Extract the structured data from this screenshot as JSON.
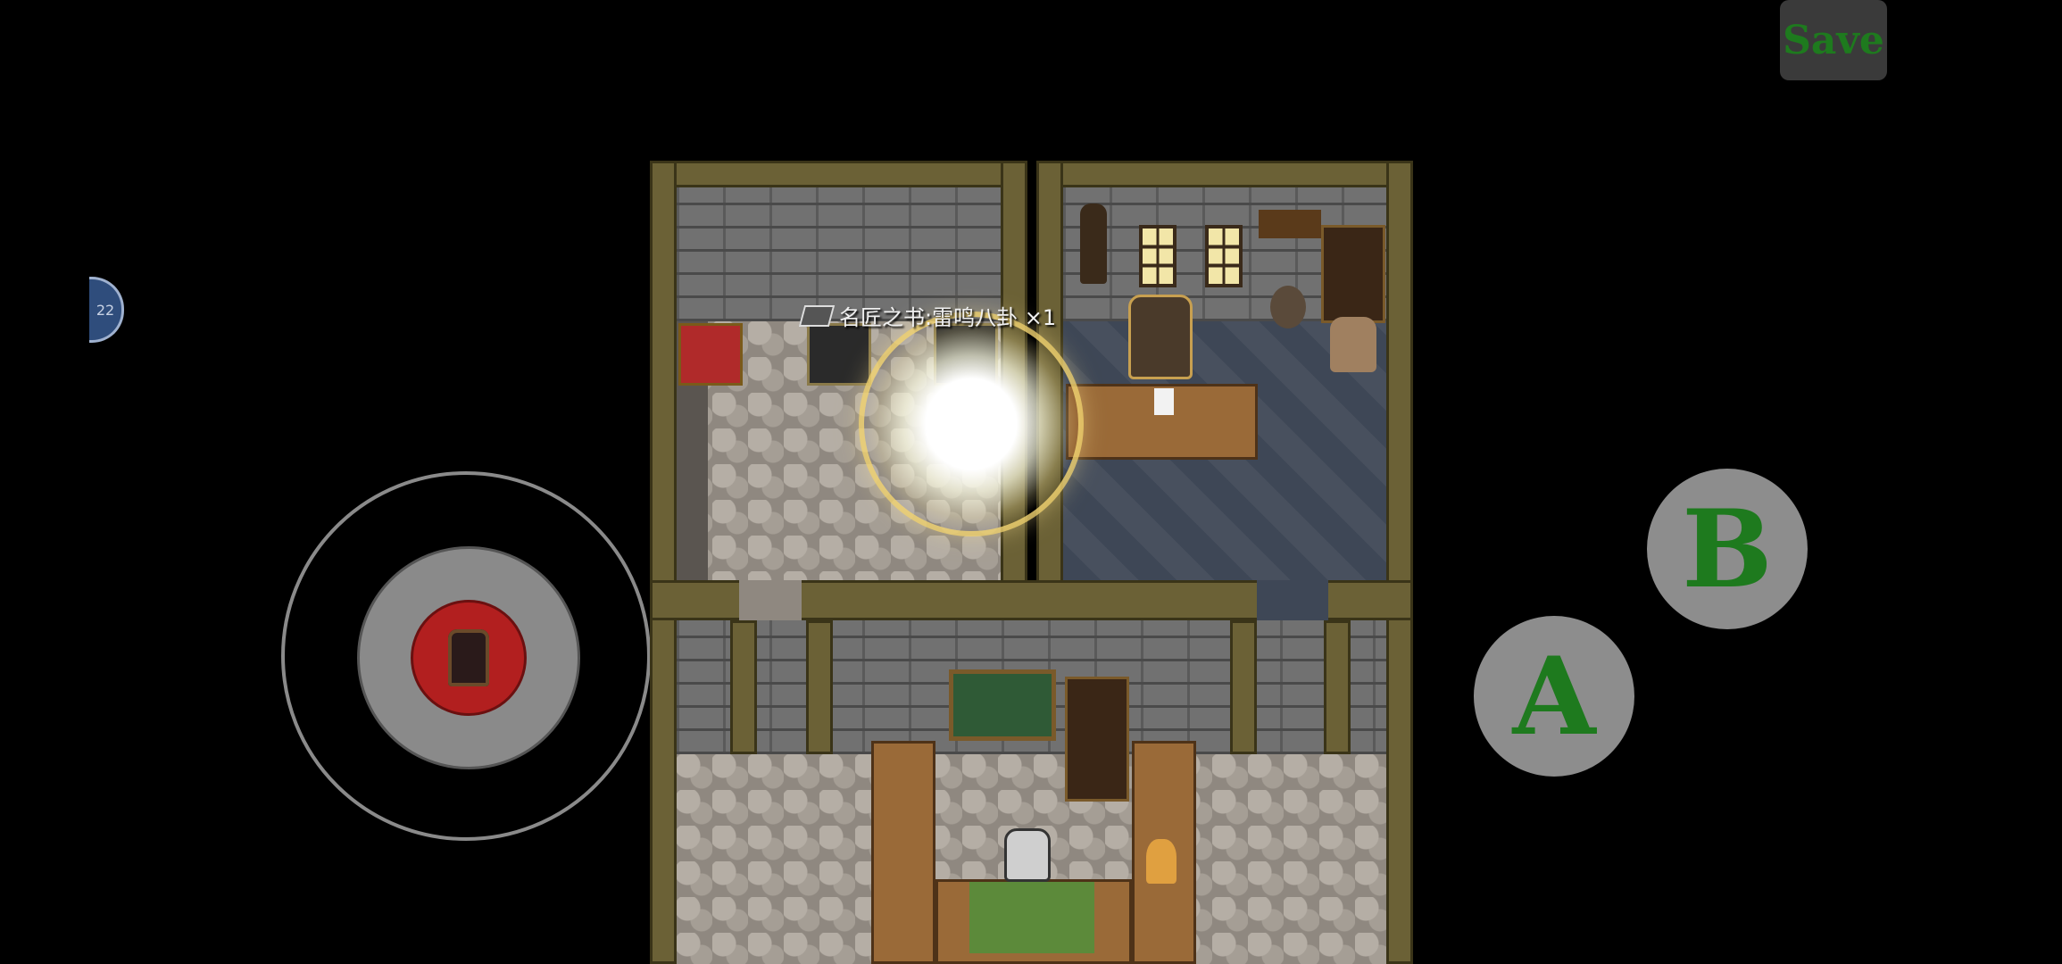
{
  "hud": {
    "save_label": "Save",
    "left_badge_text": "22",
    "button_a_label": "A",
    "button_b_label": "B"
  },
  "notification": {
    "item_text": "名匠之书:雷鸣八卦 ×1",
    "icon": "book-icon"
  },
  "colors": {
    "button_text": "#1e7a1e",
    "joystick_knob": "#b21f1f",
    "pad_button": "#8d8d8d"
  }
}
